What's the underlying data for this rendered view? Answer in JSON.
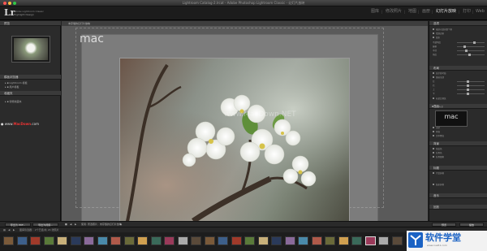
{
  "window": {
    "title": "Lightroom Catalog-2.lrcat - Adobe Photoshop Lightroom Classic - 幻灯片放映",
    "traffic_lights": [
      "#fc5753",
      "#fdbc40",
      "#33c748"
    ]
  },
  "identity": {
    "logo": "Lr",
    "subtitle": "Adobe Lightroom Classic",
    "user": "Highlight Design"
  },
  "modules": [
    {
      "label": "图库",
      "active": false
    },
    {
      "label": "修改照片",
      "active": false
    },
    {
      "label": "地图",
      "active": false
    },
    {
      "label": "画册",
      "active": false
    },
    {
      "label": "幻灯片放映",
      "active": true
    },
    {
      "label": "打印",
      "active": false
    },
    {
      "label": "Web",
      "active": false
    }
  ],
  "left_panel": {
    "preview_header": "预览",
    "template_browser_header": "模板浏览器",
    "templates": [
      "Lightroom 模板",
      "用户模板"
    ],
    "collections_header": "收藏夹",
    "collections": [
      "智能收藏夹"
    ],
    "watermark": {
      "prefix": "www.",
      "brand": "MacDown",
      "suffix": ".com"
    }
  },
  "center": {
    "header": "未存储的幻灯片放映",
    "overlay_text": "mac",
    "photo_watermark": "www.MacDown.NET",
    "toolbar_text": "使用: 所选照片 · 未存储的幻灯片放映",
    "toolbar_play_icon": "play-icon",
    "toolbar_stop_icon": "stop-icon"
  },
  "bottom_buttons": {
    "export_pdf": "导出为 PDF...",
    "export_video": "导出为视频...",
    "preview": "预览",
    "play": "播放"
  },
  "right_panel": {
    "headers": [
      "选项",
      "布局",
      "叠加",
      "背景",
      "标题",
      "音乐",
      "回放"
    ],
    "rows": [
      "缩放以填充整个框",
      "绘制边框",
      "投影",
      "不透明度",
      "偏移",
      "半径",
      "角度",
      "显示参考线",
      "链接全部",
      "左",
      "右",
      "上",
      "下",
      "长宽比预览",
      "身份标识",
      "水印",
      "星级",
      "文本叠加",
      "渐变色",
      "背景色",
      "背景图像",
      "介绍屏幕",
      "结束屏幕"
    ],
    "identity_plate": "mac"
  },
  "filmstrip": {
    "info": "图库筛选器: · 2个已选/共 24 张照片",
    "thumbnail_count": 30
  },
  "brand_logo": {
    "text": "软件学堂",
    "url": "www.xue51.com"
  }
}
